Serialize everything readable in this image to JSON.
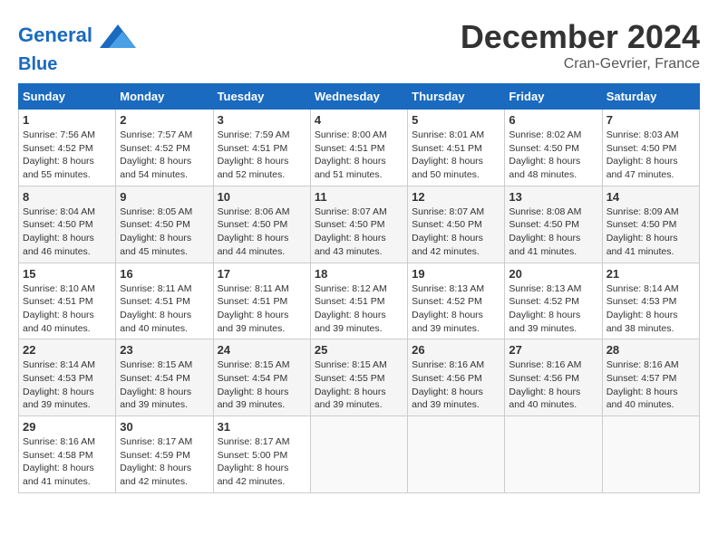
{
  "header": {
    "logo_line1": "General",
    "logo_line2": "Blue",
    "month": "December 2024",
    "location": "Cran-Gevrier, France"
  },
  "weekdays": [
    "Sunday",
    "Monday",
    "Tuesday",
    "Wednesday",
    "Thursday",
    "Friday",
    "Saturday"
  ],
  "weeks": [
    [
      {
        "day": "1",
        "sunrise": "7:56 AM",
        "sunset": "4:52 PM",
        "daylight": "8 hours and 55 minutes."
      },
      {
        "day": "2",
        "sunrise": "7:57 AM",
        "sunset": "4:52 PM",
        "daylight": "8 hours and 54 minutes."
      },
      {
        "day": "3",
        "sunrise": "7:59 AM",
        "sunset": "4:51 PM",
        "daylight": "8 hours and 52 minutes."
      },
      {
        "day": "4",
        "sunrise": "8:00 AM",
        "sunset": "4:51 PM",
        "daylight": "8 hours and 51 minutes."
      },
      {
        "day": "5",
        "sunrise": "8:01 AM",
        "sunset": "4:51 PM",
        "daylight": "8 hours and 50 minutes."
      },
      {
        "day": "6",
        "sunrise": "8:02 AM",
        "sunset": "4:50 PM",
        "daylight": "8 hours and 48 minutes."
      },
      {
        "day": "7",
        "sunrise": "8:03 AM",
        "sunset": "4:50 PM",
        "daylight": "8 hours and 47 minutes."
      }
    ],
    [
      {
        "day": "8",
        "sunrise": "8:04 AM",
        "sunset": "4:50 PM",
        "daylight": "8 hours and 46 minutes."
      },
      {
        "day": "9",
        "sunrise": "8:05 AM",
        "sunset": "4:50 PM",
        "daylight": "8 hours and 45 minutes."
      },
      {
        "day": "10",
        "sunrise": "8:06 AM",
        "sunset": "4:50 PM",
        "daylight": "8 hours and 44 minutes."
      },
      {
        "day": "11",
        "sunrise": "8:07 AM",
        "sunset": "4:50 PM",
        "daylight": "8 hours and 43 minutes."
      },
      {
        "day": "12",
        "sunrise": "8:07 AM",
        "sunset": "4:50 PM",
        "daylight": "8 hours and 42 minutes."
      },
      {
        "day": "13",
        "sunrise": "8:08 AM",
        "sunset": "4:50 PM",
        "daylight": "8 hours and 41 minutes."
      },
      {
        "day": "14",
        "sunrise": "8:09 AM",
        "sunset": "4:50 PM",
        "daylight": "8 hours and 41 minutes."
      }
    ],
    [
      {
        "day": "15",
        "sunrise": "8:10 AM",
        "sunset": "4:51 PM",
        "daylight": "8 hours and 40 minutes."
      },
      {
        "day": "16",
        "sunrise": "8:11 AM",
        "sunset": "4:51 PM",
        "daylight": "8 hours and 40 minutes."
      },
      {
        "day": "17",
        "sunrise": "8:11 AM",
        "sunset": "4:51 PM",
        "daylight": "8 hours and 39 minutes."
      },
      {
        "day": "18",
        "sunrise": "8:12 AM",
        "sunset": "4:51 PM",
        "daylight": "8 hours and 39 minutes."
      },
      {
        "day": "19",
        "sunrise": "8:13 AM",
        "sunset": "4:52 PM",
        "daylight": "8 hours and 39 minutes."
      },
      {
        "day": "20",
        "sunrise": "8:13 AM",
        "sunset": "4:52 PM",
        "daylight": "8 hours and 39 minutes."
      },
      {
        "day": "21",
        "sunrise": "8:14 AM",
        "sunset": "4:53 PM",
        "daylight": "8 hours and 38 minutes."
      }
    ],
    [
      {
        "day": "22",
        "sunrise": "8:14 AM",
        "sunset": "4:53 PM",
        "daylight": "8 hours and 39 minutes."
      },
      {
        "day": "23",
        "sunrise": "8:15 AM",
        "sunset": "4:54 PM",
        "daylight": "8 hours and 39 minutes."
      },
      {
        "day": "24",
        "sunrise": "8:15 AM",
        "sunset": "4:54 PM",
        "daylight": "8 hours and 39 minutes."
      },
      {
        "day": "25",
        "sunrise": "8:15 AM",
        "sunset": "4:55 PM",
        "daylight": "8 hours and 39 minutes."
      },
      {
        "day": "26",
        "sunrise": "8:16 AM",
        "sunset": "4:56 PM",
        "daylight": "8 hours and 39 minutes."
      },
      {
        "day": "27",
        "sunrise": "8:16 AM",
        "sunset": "4:56 PM",
        "daylight": "8 hours and 40 minutes."
      },
      {
        "day": "28",
        "sunrise": "8:16 AM",
        "sunset": "4:57 PM",
        "daylight": "8 hours and 40 minutes."
      }
    ],
    [
      {
        "day": "29",
        "sunrise": "8:16 AM",
        "sunset": "4:58 PM",
        "daylight": "8 hours and 41 minutes."
      },
      {
        "day": "30",
        "sunrise": "8:17 AM",
        "sunset": "4:59 PM",
        "daylight": "8 hours and 42 minutes."
      },
      {
        "day": "31",
        "sunrise": "8:17 AM",
        "sunset": "5:00 PM",
        "daylight": "8 hours and 42 minutes."
      },
      null,
      null,
      null,
      null
    ]
  ],
  "labels": {
    "sunrise": "Sunrise:",
    "sunset": "Sunset:",
    "daylight": "Daylight:"
  }
}
